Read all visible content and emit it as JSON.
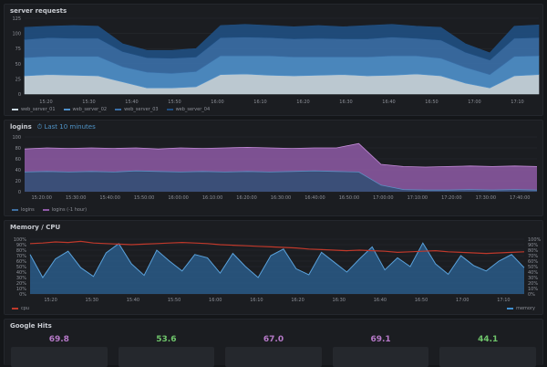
{
  "panels": {
    "requests": {
      "title": "server requests",
      "legend": [
        {
          "label": "web_server_01",
          "color": "#c9d7e0"
        },
        {
          "label": "web_server_02",
          "color": "#4e8fc9"
        },
        {
          "label": "web_server_03",
          "color": "#3a6ea6"
        },
        {
          "label": "web_server_04",
          "color": "#1f4e80"
        }
      ]
    },
    "logins": {
      "title": "logins",
      "subtitle": "Last 10 minutes",
      "legend": [
        {
          "label": "logins",
          "color": "#3f6fa0"
        },
        {
          "label": "logins (-1 hour)",
          "color": "#8e5aa6"
        }
      ]
    },
    "memory": {
      "title": "Memory / CPU",
      "legend_left": {
        "label": "cpu",
        "color": "#c0392b"
      },
      "legend_right": {
        "label": "memory",
        "color": "#3f8fd0"
      }
    },
    "gauges": {
      "title": "Google Hits",
      "items": [
        {
          "value": "69.8",
          "color": "#b679c8"
        },
        {
          "value": "53.6",
          "color": "#6fc56b"
        },
        {
          "value": "67.0",
          "color": "#b679c8"
        },
        {
          "value": "69.1",
          "color": "#b679c8"
        },
        {
          "value": "44.1",
          "color": "#6fc56b"
        }
      ]
    }
  },
  "chart_data": [
    {
      "type": "area",
      "title": "server requests",
      "ylim": [
        0,
        125
      ],
      "y_ticks": [
        "125",
        "100",
        "75",
        "50",
        "25",
        "0"
      ],
      "x_ticks": [
        "15:20",
        "15:30",
        "15:40",
        "15:50",
        "16:00",
        "16:10",
        "16:20",
        "16:30",
        "16:40",
        "16:50",
        "17:00",
        "17:10"
      ],
      "stacked": true,
      "series": [
        {
          "name": "web_server_01",
          "values": [
            30,
            32,
            31,
            30,
            20,
            10,
            10,
            12,
            32,
            33,
            31,
            30,
            31,
            32,
            30,
            31,
            33,
            30,
            18,
            10,
            30,
            32
          ]
        },
        {
          "name": "web_server_02",
          "values": [
            30,
            30,
            31,
            32,
            25,
            26,
            24,
            25,
            31,
            30,
            32,
            31,
            30,
            29,
            31,
            32,
            30,
            29,
            26,
            22,
            32,
            31
          ]
        },
        {
          "name": "web_server_03",
          "values": [
            30,
            31,
            30,
            30,
            25,
            24,
            25,
            24,
            30,
            31,
            30,
            30,
            31,
            30,
            30,
            31,
            29,
            30,
            25,
            24,
            30,
            30
          ]
        },
        {
          "name": "web_server_04",
          "values": [
            20,
            19,
            21,
            20,
            13,
            12,
            13,
            14,
            20,
            21,
            20,
            20,
            21,
            20,
            22,
            21,
            20,
            21,
            14,
            12,
            20,
            21
          ]
        }
      ]
    },
    {
      "type": "area",
      "title": "logins",
      "ylim": [
        0,
        100
      ],
      "y_ticks": [
        "100",
        "80",
        "60",
        "40",
        "20",
        "0"
      ],
      "x_ticks": [
        "15:20:00",
        "15:30:00",
        "15:40:00",
        "15:50:00",
        "16:00:00",
        "16:10:00",
        "16:20:00",
        "16:30:00",
        "16:40:00",
        "16:50:00",
        "17:00:00",
        "17:10:00",
        "17:20:00",
        "17:30:00",
        "17:40:00"
      ],
      "series": [
        {
          "name": "logins (-1 hour)",
          "values": [
            78,
            80,
            79,
            80,
            79,
            80,
            78,
            80,
            79,
            80,
            81,
            80,
            79,
            80,
            80,
            88,
            50,
            46,
            45,
            46,
            47,
            46,
            47,
            46
          ]
        },
        {
          "name": "logins",
          "values": [
            36,
            37,
            36,
            37,
            36,
            38,
            37,
            36,
            37,
            36,
            37,
            36,
            37,
            38,
            37,
            36,
            12,
            4,
            3,
            3,
            4,
            3,
            4,
            3
          ]
        }
      ]
    },
    {
      "type": "line",
      "title": "Memory / CPU",
      "y_ticks_left": [
        "100%",
        "90%",
        "80%",
        "70%",
        "60%",
        "50%",
        "40%",
        "30%",
        "20%",
        "10%",
        "0%"
      ],
      "y_ticks_right": [
        "100%",
        "90%",
        "80%",
        "70%",
        "60%",
        "50%",
        "40%",
        "30%",
        "20%",
        "10%",
        "0%"
      ],
      "x_ticks": [
        "15:20",
        "15:30",
        "15:40",
        "15:50",
        "16:00",
        "16:10",
        "16:20",
        "16:30",
        "16:40",
        "16:50",
        "17:00",
        "17:10"
      ],
      "series": [
        {
          "name": "cpu",
          "values": [
            92,
            93,
            95,
            94,
            96,
            93,
            92,
            91,
            90,
            91,
            92,
            93,
            94,
            93,
            92,
            90,
            89,
            88,
            87,
            86,
            85,
            84,
            82,
            81,
            80,
            79,
            80,
            79,
            78,
            76,
            77,
            78,
            79,
            77,
            76,
            75,
            74,
            75,
            76,
            77
          ]
        },
        {
          "name": "memory",
          "values": [
            72,
            30,
            64,
            78,
            48,
            32,
            75,
            92,
            55,
            34,
            80,
            60,
            42,
            72,
            66,
            38,
            74,
            50,
            30,
            70,
            82,
            46,
            35,
            76,
            58,
            40,
            64,
            86,
            44,
            66,
            50,
            93,
            55,
            36,
            70,
            52,
            42,
            60,
            72,
            48
          ]
        }
      ]
    }
  ]
}
